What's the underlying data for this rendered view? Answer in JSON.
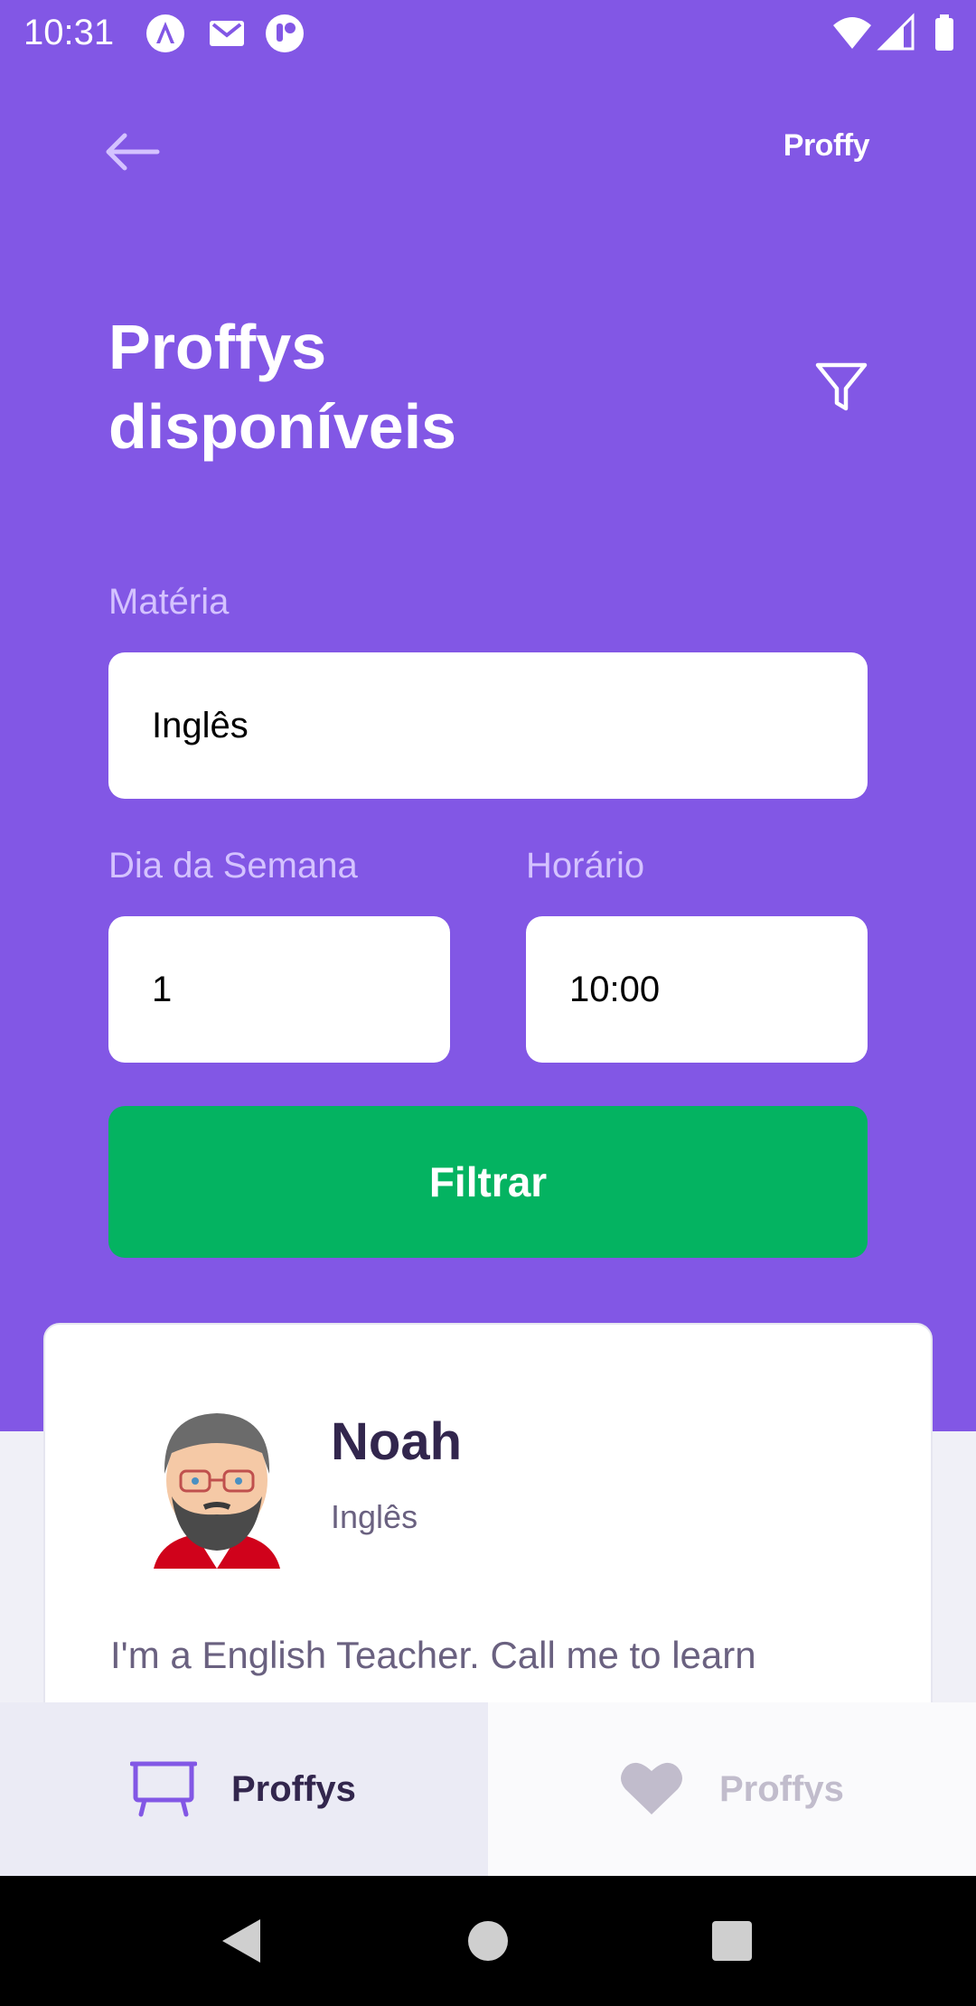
{
  "status_bar": {
    "time": "10:31",
    "left_icons": [
      "apollo-icon",
      "gmail-icon",
      "app-icon"
    ],
    "right_icons": [
      "wifi-icon",
      "signal-icon",
      "battery-icon"
    ]
  },
  "header": {
    "brand": "Proffy",
    "title_line1": "Proffys",
    "title_line2": "disponíveis"
  },
  "filters": {
    "subject_label": "Matéria",
    "subject_value": "Inglês",
    "weekday_label": "Dia da Semana",
    "weekday_value": "1",
    "time_label": "Horário",
    "time_value": "10:00",
    "submit_label": "Filtrar"
  },
  "teacher": {
    "name": "Noah",
    "subject": "Inglês",
    "bio": "I'm a English Teacher. Call me to learn"
  },
  "tabs": [
    {
      "label": "Proffys",
      "icon": "easel-icon",
      "active": true
    },
    {
      "label": "Proffys",
      "icon": "heart-icon",
      "active": false
    }
  ],
  "colors": {
    "primary": "#8257E5",
    "button_green": "#04B361",
    "label_purple": "#D4C2FF",
    "title_dark": "#32264D",
    "text_muted": "#6A6180"
  }
}
